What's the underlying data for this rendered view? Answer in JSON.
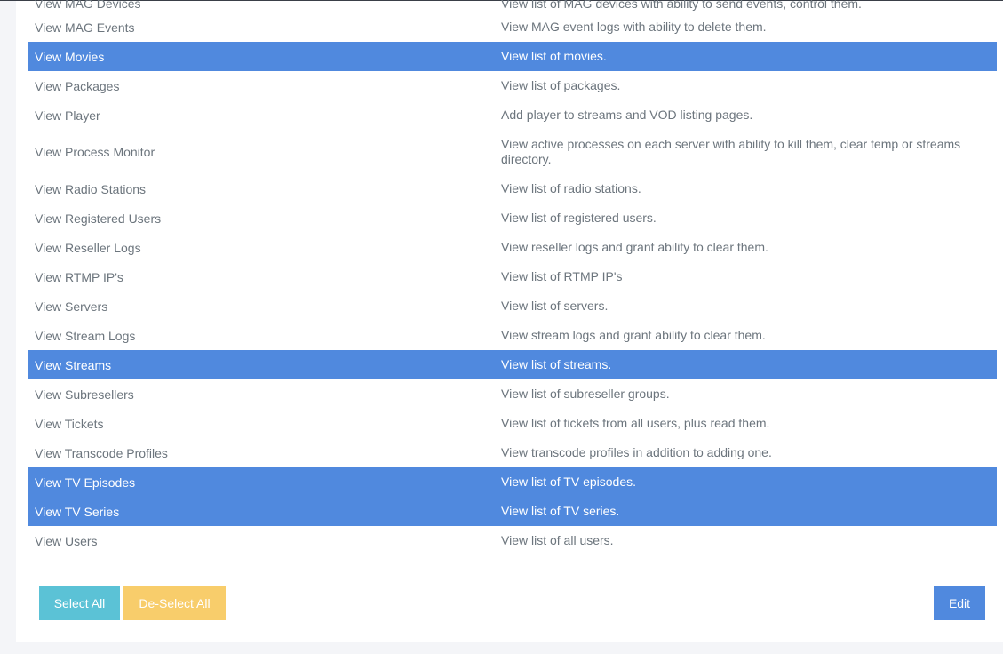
{
  "permissions": [
    {
      "name": "View MAG Devices",
      "description": "View list of MAG devices with ability to send events, control them.",
      "selected": false
    },
    {
      "name": "View MAG Events",
      "description": "View MAG event logs with ability to delete them.",
      "selected": false
    },
    {
      "name": "View Movies",
      "description": "View list of movies.",
      "selected": true
    },
    {
      "name": "View Packages",
      "description": "View list of packages.",
      "selected": false
    },
    {
      "name": "View Player",
      "description": "Add player to streams and VOD listing pages.",
      "selected": false
    },
    {
      "name": "View Process Monitor",
      "description": "View active processes on each server with ability to kill them, clear temp or streams directory.",
      "selected": false
    },
    {
      "name": "View Radio Stations",
      "description": "View list of radio stations.",
      "selected": false
    },
    {
      "name": "View Registered Users",
      "description": "View list of registered users.",
      "selected": false
    },
    {
      "name": "View Reseller Logs",
      "description": "View reseller logs and grant ability to clear them.",
      "selected": false
    },
    {
      "name": "View RTMP IP's",
      "description": "View list of RTMP IP's",
      "selected": false
    },
    {
      "name": "View Servers",
      "description": "View list of servers.",
      "selected": false
    },
    {
      "name": "View Stream Logs",
      "description": "View stream logs and grant ability to clear them.",
      "selected": false
    },
    {
      "name": "View Streams",
      "description": "View list of streams.",
      "selected": true
    },
    {
      "name": "View Subresellers",
      "description": "View list of subreseller groups.",
      "selected": false
    },
    {
      "name": "View Tickets",
      "description": "View list of tickets from all users, plus read them.",
      "selected": false
    },
    {
      "name": "View Transcode Profiles",
      "description": "View transcode profiles in addition to adding one.",
      "selected": false
    },
    {
      "name": "View TV Episodes",
      "description": "View list of TV episodes.",
      "selected": true
    },
    {
      "name": "View TV Series",
      "description": "View list of TV series.",
      "selected": true
    },
    {
      "name": "View Users",
      "description": "View list of all users.",
      "selected": false
    }
  ],
  "buttons": {
    "select_all": "Select All",
    "deselect_all": "De-Select All",
    "edit": "Edit"
  },
  "colors": {
    "selected_row": "#5089de",
    "select_all": "#5bc2d6",
    "deselect_all": "#f8cd6b",
    "edit": "#5089de"
  }
}
